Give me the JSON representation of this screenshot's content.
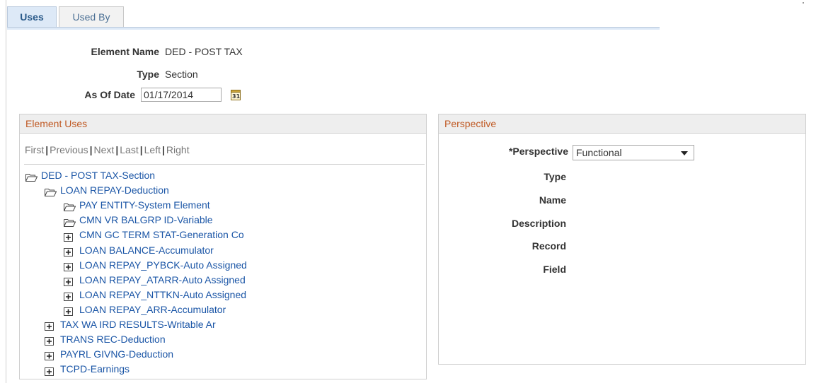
{
  "tabs": {
    "uses_label": "Uses",
    "used_by_label": "Used By"
  },
  "header": {
    "element_name_label": "Element Name",
    "element_name_value": "DED - POST TAX",
    "type_label": "Type",
    "type_value": "Section",
    "as_of_date_label": "As Of Date",
    "as_of_date_value": "01/17/2014"
  },
  "element_uses": {
    "title": "Element Uses",
    "nav": [
      "First",
      "Previous",
      "Next",
      "Last",
      "Left",
      "Right"
    ],
    "tree": [
      {
        "label": "DED - POST TAX-Section",
        "icon": "folder-open-icon",
        "level": 0
      },
      {
        "label": "LOAN REPAY-Deduction",
        "icon": "folder-open-icon",
        "level": 1
      },
      {
        "label": "PAY ENTITY-System Element",
        "icon": "folder-open-icon",
        "level": 2
      },
      {
        "label": "CMN VR BALGRP ID-Variable",
        "icon": "folder-open-icon",
        "level": 2
      },
      {
        "label": "CMN GC TERM STAT-Generation Co",
        "icon": "expand-icon",
        "level": 2
      },
      {
        "label": "LOAN BALANCE-Accumulator",
        "icon": "expand-icon",
        "level": 2
      },
      {
        "label": "LOAN REPAY_PYBCK-Auto Assigned",
        "icon": "expand-icon",
        "level": 2
      },
      {
        "label": "LOAN REPAY_ATARR-Auto Assigned",
        "icon": "expand-icon",
        "level": 2
      },
      {
        "label": "LOAN REPAY_NTTKN-Auto Assigned",
        "icon": "expand-icon",
        "level": 2
      },
      {
        "label": "LOAN REPAY_ARR-Accumulator",
        "icon": "expand-icon",
        "level": 2
      },
      {
        "label": "TAX WA IRD RESULTS-Writable Ar",
        "icon": "expand-icon",
        "level": 1
      },
      {
        "label": "TRANS REC-Deduction",
        "icon": "expand-icon",
        "level": 1
      },
      {
        "label": "PAYRL GIVNG-Deduction",
        "icon": "expand-icon",
        "level": 1
      },
      {
        "label": "TCPD-Earnings",
        "icon": "expand-icon",
        "level": 1
      }
    ]
  },
  "perspective": {
    "title": "Perspective",
    "perspective_label": "*Perspective",
    "perspective_value": "Functional",
    "fields": [
      "Type",
      "Name",
      "Description",
      "Record",
      "Field"
    ]
  },
  "colors": {
    "link": "#1a55a6",
    "section_title": "#c05a24",
    "tab_active_bg": "#dde9f7"
  }
}
